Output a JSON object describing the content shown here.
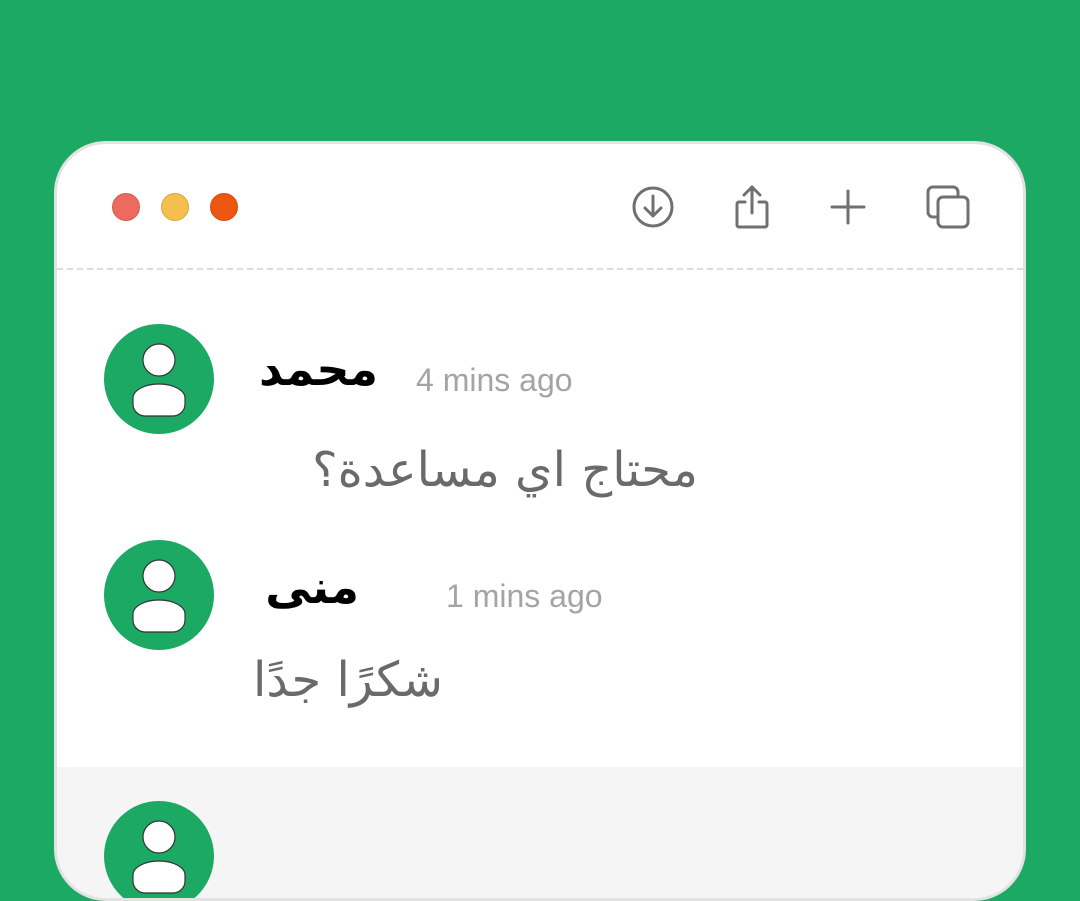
{
  "window": {
    "traffic_lights": [
      {
        "name": "close",
        "color": "#ec6a5e"
      },
      {
        "name": "minimize",
        "color": "#f4bf4f"
      },
      {
        "name": "zoom",
        "color": "#ec560e"
      }
    ],
    "toolbar": [
      {
        "icon": "download-icon"
      },
      {
        "icon": "share-icon"
      },
      {
        "icon": "plus-icon"
      },
      {
        "icon": "copy-icon"
      }
    ]
  },
  "messages": [
    {
      "author": "محمد",
      "time": "4 mins ago",
      "text": "محتاج اي مساعدة؟",
      "avatar_icon": "user-icon"
    },
    {
      "author": "منى",
      "time": "1 mins ago",
      "text": "شكرًا جدًا",
      "avatar_icon": "user-icon"
    }
  ],
  "colors": {
    "background": "#1ba963",
    "accent": "#1ba963",
    "time_text": "#a4a4a4",
    "message_text": "#6a6a6a"
  }
}
